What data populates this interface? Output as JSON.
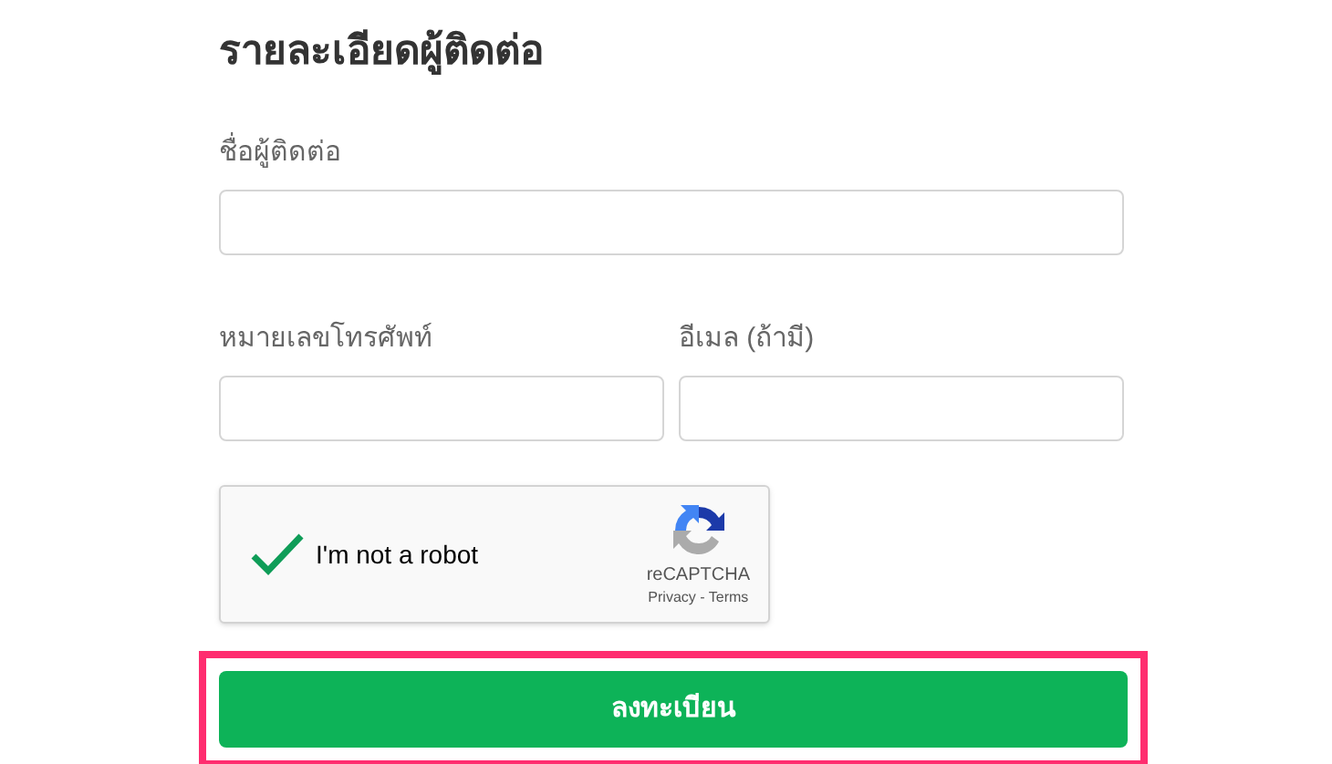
{
  "heading": "รายละเอียดผู้ติดต่อ",
  "fields": [
    {
      "label": "ชื่อผู้ติดต่อ",
      "kind": "full"
    },
    {
      "label": "หมายเลขโทรศัพท์",
      "kind": "half"
    },
    {
      "label": "อีเมล (ถ้ามี)",
      "kind": "half"
    }
  ],
  "captcha": {
    "label": "I'm not a robot",
    "checked": true,
    "brand": "reCAPTCHA",
    "links": "Privacy - Terms"
  },
  "submit": {
    "label": "ลงทะเบียน",
    "highlighted": true
  }
}
